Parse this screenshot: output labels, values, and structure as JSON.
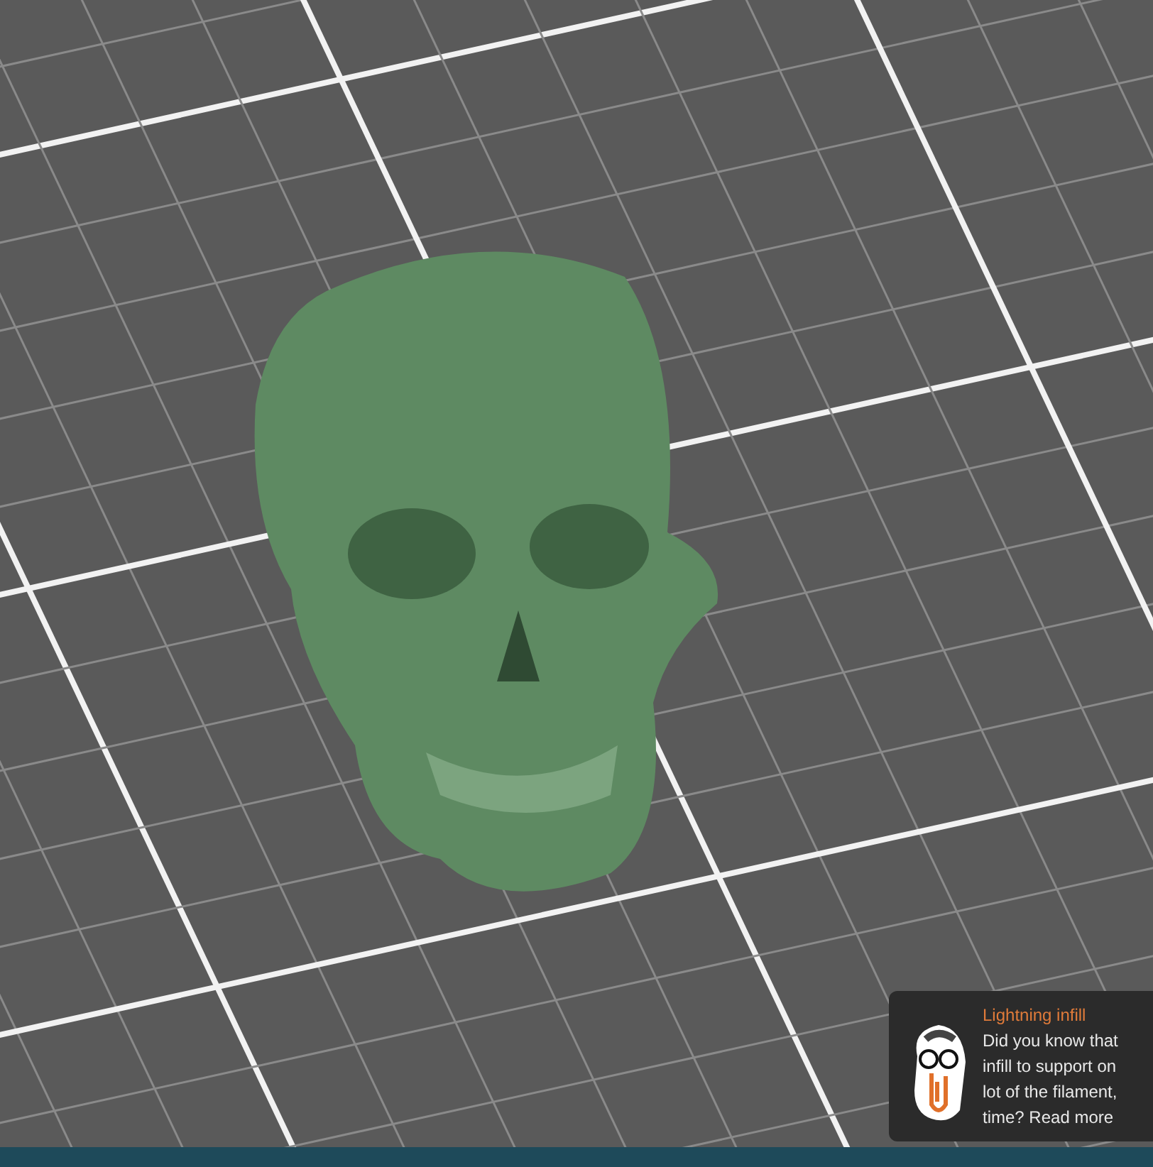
{
  "tip": {
    "title": "Lightning infill",
    "lines": [
      "Did you know that",
      "infill to support on",
      "lot of the filament,",
      "time? Read more"
    ]
  }
}
